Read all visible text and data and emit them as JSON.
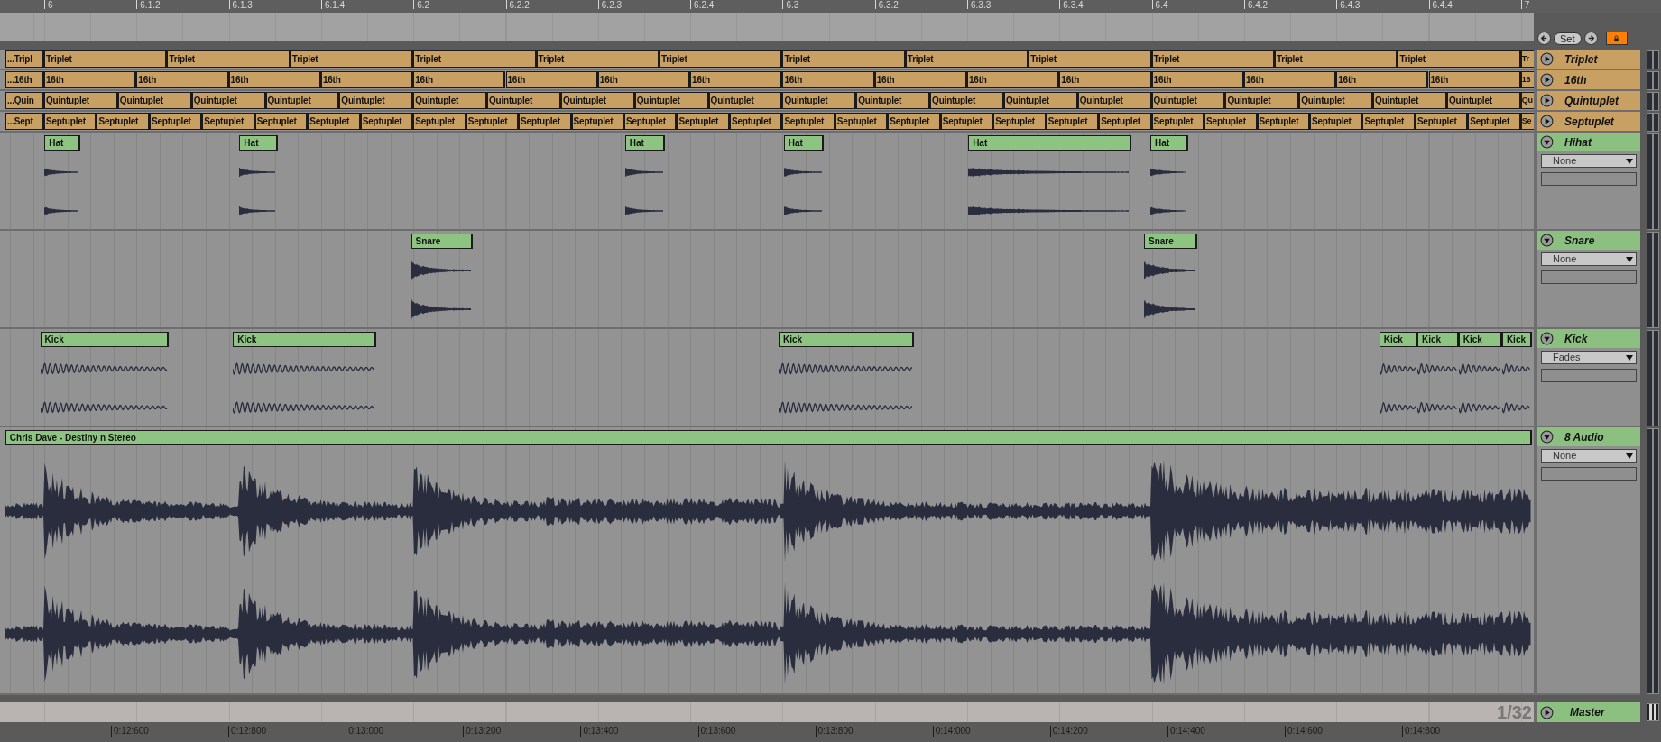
{
  "ruler": [
    "6",
    "6.1.2",
    "6.1.3",
    "6.1.4",
    "6.2",
    "6.2.2",
    "6.2.3",
    "6.2.4",
    "6.3",
    "6.3.2",
    "6.3.3",
    "6.3.4",
    "6.4",
    "6.4.2",
    "6.4.3",
    "6.4.4",
    "7"
  ],
  "cue_controls": {
    "set_label": "Set"
  },
  "locators": [
    {
      "name": "Triplet",
      "clips": [
        "...Tripl",
        "Triplet",
        "Triplet",
        "Triplet",
        "Triplet",
        "Triplet",
        "Triplet",
        "Triplet",
        "Triplet",
        "Triplet",
        "Triplet",
        "Triplet",
        "Triplet",
        "Tr"
      ]
    },
    {
      "name": "16th",
      "clips": [
        "...16th",
        "16th",
        "16th",
        "16th",
        "16th",
        "16th",
        "16th",
        "16th",
        "16th",
        "16th",
        "16th",
        "16th",
        "16th",
        "16th",
        "16th",
        "16th",
        "16th",
        "16"
      ]
    },
    {
      "name": "Quintuplet",
      "clips": [
        "...Quin",
        "Quintuplet",
        "Quintuplet",
        "Quintuplet",
        "Quintuplet",
        "Quintuplet",
        "Quintuplet",
        "Quintuplet",
        "Quintuplet",
        "Quintuplet",
        "Quintuplet",
        "Quintuplet",
        "Quintuplet",
        "Quintuplet",
        "Quintuplet",
        "Quintuplet",
        "Quintuplet",
        "Quintuplet",
        "Quintuplet",
        "Quintuplet",
        "Quintuplet",
        "Qu"
      ]
    },
    {
      "name": "Septuplet",
      "clips": [
        "...Sept",
        "Septuplet",
        "Septuplet",
        "Septuplet",
        "Septuplet",
        "Septuplet",
        "Septuplet",
        "Septuplet",
        "Septuplet",
        "Septuplet",
        "Septuplet",
        "Septuplet",
        "Septuplet",
        "Septuplet",
        "Septuplet",
        "Septuplet",
        "Septuplet",
        "Septuplet",
        "Septuplet",
        "Septuplet",
        "Septuplet",
        "Septuplet",
        "Septuplet",
        "Septuplet",
        "Septuplet",
        "Septuplet",
        "Septuplet",
        "Septuplet",
        "Septuplet",
        "Se"
      ]
    }
  ],
  "tracks": [
    {
      "name": "Hihat",
      "kind": "hat",
      "clips": [
        "Hat",
        "Hat",
        "Hat",
        "Hat",
        "Hat",
        "Hat"
      ],
      "fade_mode": "None"
    },
    {
      "name": "Snare",
      "kind": "snare",
      "clips": [
        "Snare",
        "Snare"
      ],
      "fade_mode": "None"
    },
    {
      "name": "Kick",
      "kind": "kick",
      "clips": [
        "Kick",
        "Kick",
        "Kick",
        "Kick",
        "Kick",
        "Kick",
        "Kick"
      ],
      "fade_mode": "Fades"
    },
    {
      "name": "8 Audio",
      "kind": "audio",
      "clips": [
        "Chris Dave - Destiny n Stereo"
      ],
      "fade_mode": "None"
    }
  ],
  "grid_label": "1/32",
  "master": {
    "name": "Master"
  },
  "time_ruler": [
    "0:12:600",
    "0:12:800",
    "0:13:000",
    "0:13:200",
    "0:13:400",
    "0:13:600",
    "0:13:800",
    "0:14:000",
    "0:14:200",
    "0:14:400",
    "0:14:600",
    "0:14:800"
  ]
}
